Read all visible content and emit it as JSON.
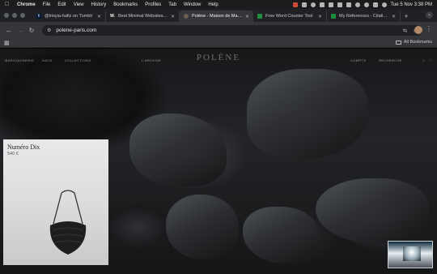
{
  "menubar": {
    "app": "Chrome",
    "menus": [
      "File",
      "Edit",
      "View",
      "History",
      "Bookmarks",
      "Profiles",
      "Tab",
      "Window",
      "Help"
    ],
    "clock": "Tue 5 Nov  3:38 PM"
  },
  "tabs": [
    {
      "title": "@trisyia-hafiz on Tumblr",
      "favicon": "t",
      "active": false
    },
    {
      "title": "Best Minimal Websites | …",
      "favicon": "W.",
      "active": false
    },
    {
      "title": "Polène - Maison de Maro…",
      "favicon": "",
      "active": true
    },
    {
      "title": "Free Word Counter Tool",
      "favicon": "",
      "active": false
    },
    {
      "title": "My References - Citation…",
      "favicon": "",
      "active": false
    }
  ],
  "toolbar": {
    "url": "polene-paris.com"
  },
  "bookmarks": {
    "all_label": "All Bookmarks"
  },
  "site": {
    "brand": "POLÈNE",
    "nav_left": [
      "MAROQUINERIE",
      "SACS",
      "COLLECTIONS",
      "",
      "L'ARCHIVE"
    ],
    "nav_right": [
      "COMPTE",
      "RECHERCHE"
    ]
  },
  "product": {
    "title": "Numéro Dix",
    "price": "540 €"
  },
  "colors": {
    "menubar_bg": "#1c1c1e",
    "tabstrip_bg": "#202124",
    "toolbar_bg": "#35363a",
    "card_bg": "#e2e2e3"
  }
}
